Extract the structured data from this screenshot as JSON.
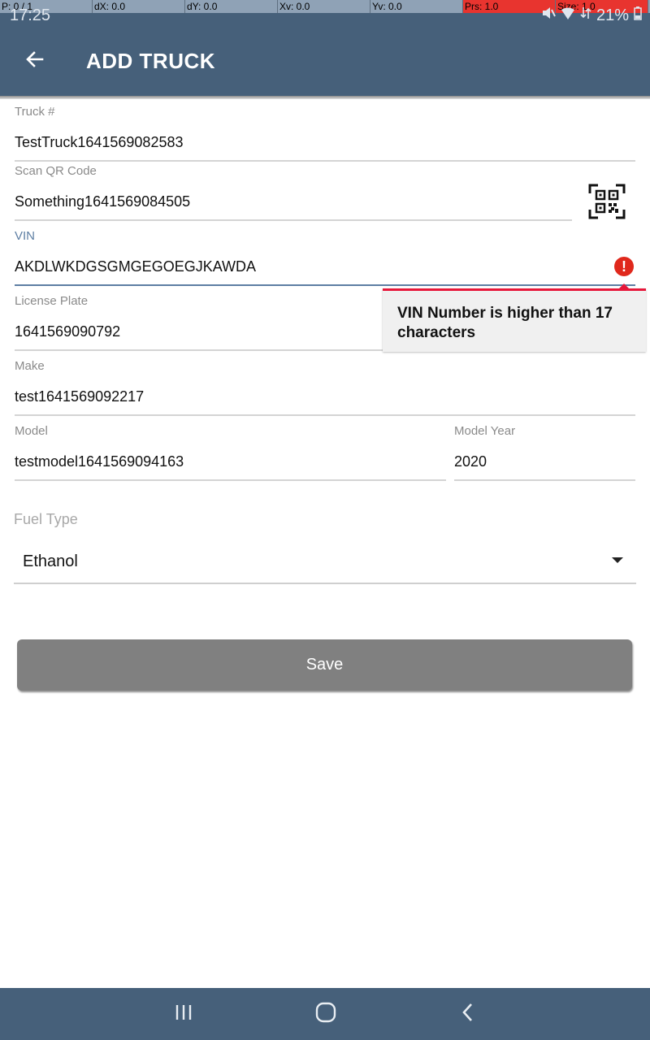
{
  "debug": {
    "cells": [
      "P: 0 / 1",
      "dX: 0.0",
      "dY: 0.0",
      "Xv: 0.0",
      "Yv: 0.0",
      "Prs: 1.0",
      "Size: 1.0"
    ]
  },
  "status_bar": {
    "time": "17:25",
    "battery": "21%"
  },
  "header": {
    "title": "ADD TRUCK",
    "background": "#46607a"
  },
  "form": {
    "truck_number": {
      "label": "Truck #",
      "value": "TestTruck1641569082583"
    },
    "qr_code": {
      "label": "Scan QR Code",
      "value": "Something1641569084505"
    },
    "vin": {
      "label": "VIN",
      "value": "AKDLWKDGSGMGEGOEGJKAWDA"
    },
    "license_plate": {
      "label": "License Plate",
      "value": "1641569090792"
    },
    "make": {
      "label": "Make",
      "value": "test1641569092217"
    },
    "model": {
      "label": "Model",
      "value": "testmodel1641569094163"
    },
    "model_year": {
      "label": "Model Year",
      "value": "2020"
    },
    "fuel_type": {
      "label": "Fuel Type",
      "value": "Ethanol"
    }
  },
  "vin_error": {
    "message": "VIN Number is higher than 17 characters",
    "icon_text": "!",
    "color": "#e0281c"
  },
  "actions": {
    "save_label": "Save"
  },
  "icons": {
    "back": "arrow-left-icon",
    "qr": "qr-code-icon",
    "error": "error-icon",
    "dropdown": "caret-down-icon",
    "nav_recents": "recents-icon",
    "nav_home": "home-icon",
    "nav_back": "nav-back-icon"
  }
}
